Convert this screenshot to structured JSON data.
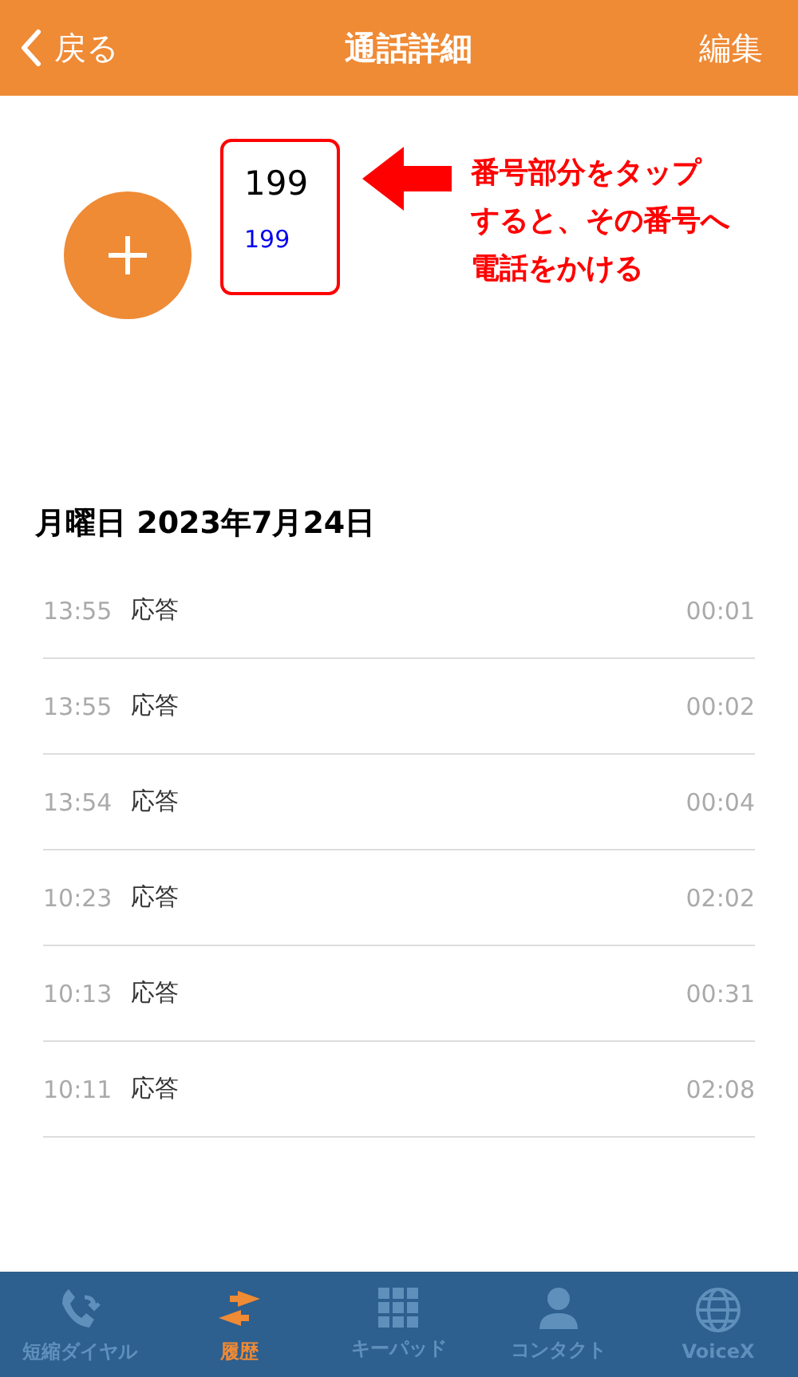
{
  "nav": {
    "back": "戻る",
    "title": "通話詳細",
    "action": "編集"
  },
  "contact": {
    "name": "199",
    "number": "199"
  },
  "annotation": {
    "lines": [
      "番号部分をタップ",
      "すると、その番号へ",
      "電話をかける"
    ]
  },
  "date": "月曜日 2023年7月24日",
  "calls": [
    {
      "time": "13:55",
      "type": "応答",
      "duration": "00:01"
    },
    {
      "time": "13:55",
      "type": "応答",
      "duration": "00:02"
    },
    {
      "time": "13:54",
      "type": "応答",
      "duration": "00:04"
    },
    {
      "time": "10:23",
      "type": "応答",
      "duration": "02:02"
    },
    {
      "time": "10:13",
      "type": "応答",
      "duration": "00:31"
    },
    {
      "time": "10:11",
      "type": "応答",
      "duration": "02:08"
    }
  ],
  "tabs": [
    {
      "label": "短縮ダイヤル",
      "kind": "phone",
      "selected": false
    },
    {
      "label": "履歴",
      "kind": "arrows",
      "selected": true
    },
    {
      "label": "キーパッド",
      "kind": "keypad",
      "selected": false
    },
    {
      "label": "コンタクト",
      "kind": "person",
      "selected": false
    },
    {
      "label": "VoiceX",
      "kind": "globe",
      "selected": false
    }
  ]
}
